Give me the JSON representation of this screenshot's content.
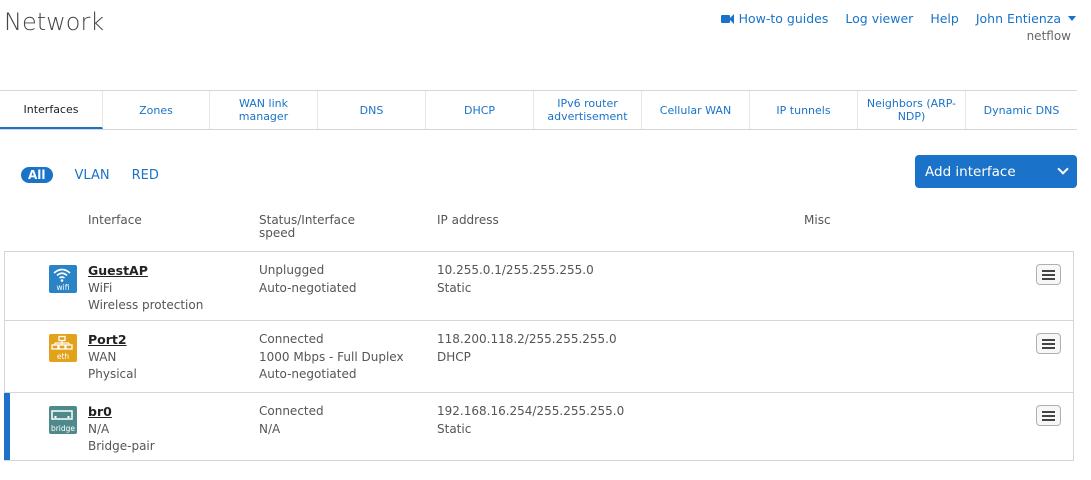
{
  "page": {
    "title": "Network"
  },
  "top_links": {
    "howto": "How-to guides",
    "log_viewer": "Log viewer",
    "help": "Help",
    "user": "John Entienza",
    "user_sub": "netflow"
  },
  "tabs": [
    {
      "label": "Interfaces",
      "active": true
    },
    {
      "label": "Zones"
    },
    {
      "label": "WAN link manager"
    },
    {
      "label": "DNS"
    },
    {
      "label": "DHCP"
    },
    {
      "label": "IPv6 router advertisement"
    },
    {
      "label": "Cellular WAN"
    },
    {
      "label": "IP tunnels"
    },
    {
      "label": "Neighbors (ARP-NDP)"
    },
    {
      "label": "Dynamic DNS"
    }
  ],
  "filters": {
    "all": "All",
    "vlan": "VLAN",
    "red": "RED"
  },
  "add_button": {
    "label": "Add interface"
  },
  "columns": {
    "interface": "Interface",
    "status": "Status/Interface speed",
    "ip": "IP address",
    "misc": "Misc"
  },
  "rows": [
    {
      "icon_label": "wifi",
      "name": "GuestAP",
      "type": "WiFi",
      "detail": "Wireless protection",
      "status1": "Unplugged",
      "status2": "Auto-negotiated",
      "status3": "",
      "ip": "10.255.0.1/255.255.255.0",
      "ip_mode": "Static"
    },
    {
      "icon_label": "eth",
      "name": "Port2",
      "type": "WAN",
      "detail": "Physical",
      "status1": "Connected",
      "status2": "1000 Mbps - Full Duplex",
      "status3": "Auto-negotiated",
      "ip": "118.200.118.2/255.255.255.0",
      "ip_mode": "DHCP"
    },
    {
      "icon_label": "bridge",
      "name": "br0",
      "type": "N/A",
      "detail": "Bridge-pair",
      "status1": "Connected",
      "status2": "N/A",
      "status3": "",
      "ip": "192.168.16.254/255.255.255.0",
      "ip_mode": "Static"
    }
  ],
  "colors": {
    "accent": "#1a73c8",
    "wifi_icon": "#2a83c5",
    "eth_icon": "#e2a21b",
    "bridge_icon": "#4f8a8b"
  }
}
